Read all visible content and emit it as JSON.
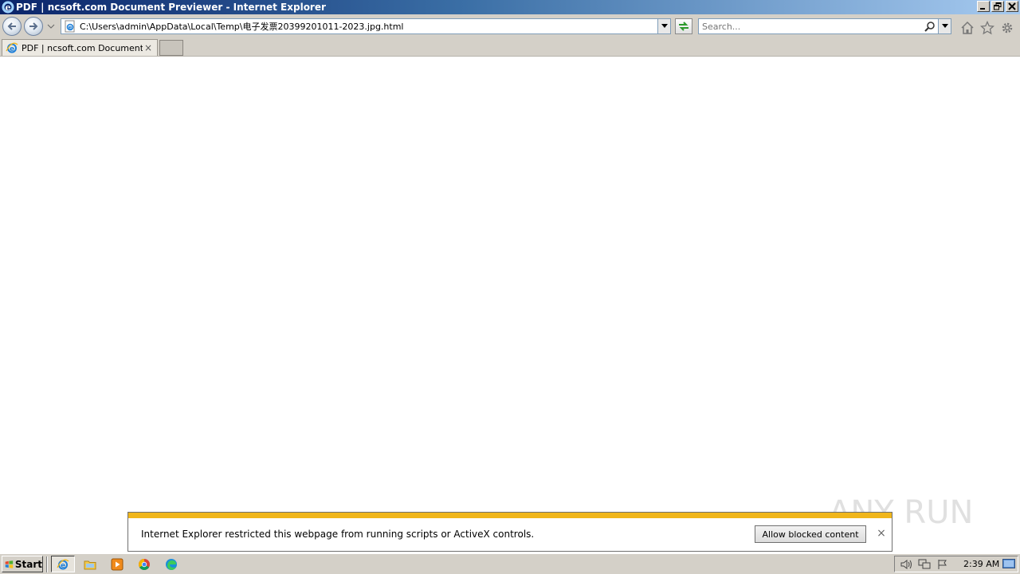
{
  "window": {
    "title": "PDF | ncsoft.com Document Previewer - Internet Explorer"
  },
  "navigation": {
    "address": "C:\\Users\\admin\\AppData\\Local\\Temp\\电子发票20399201011-2023.jpg.html",
    "search_placeholder": "Search..."
  },
  "tabs": [
    {
      "label": "PDF | ncsoft.com Document ...",
      "close": "×"
    }
  ],
  "notification": {
    "message": "Internet Explorer restricted this webpage from running scripts or ActiveX controls.",
    "button_label": "Allow blocked content",
    "close": "×"
  },
  "watermark": {
    "text": "ANY RUN"
  },
  "taskbar": {
    "start_label": "Start",
    "items": [
      "internet-explorer",
      "file-explorer",
      "media-player",
      "chrome",
      "edge"
    ],
    "clock": "2:39 AM"
  },
  "colors": {
    "notification_stripe": "#f0b61b",
    "title_gradient_start": "#0a246a",
    "title_gradient_end": "#a6caf0"
  }
}
